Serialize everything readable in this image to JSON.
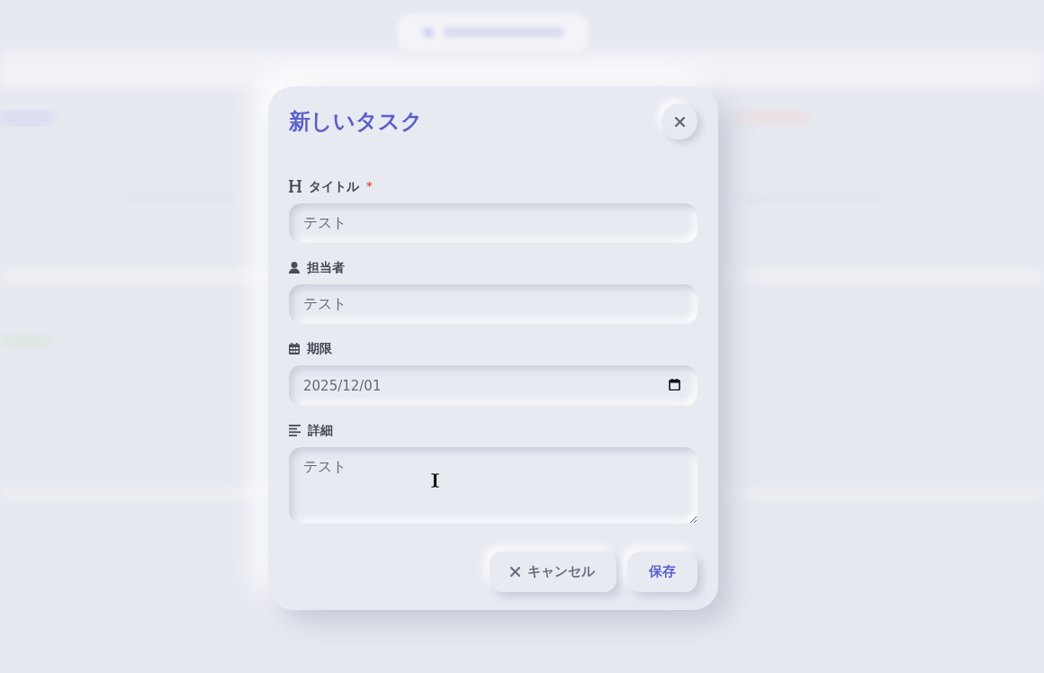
{
  "dialog": {
    "title": "新しいタスク",
    "fields": [
      {
        "kind": "text",
        "label": "タイトル",
        "required_mark": "*",
        "value": "テスト"
      },
      {
        "kind": "text",
        "label": "担当者",
        "value": "テスト"
      },
      {
        "kind": "date",
        "label": "期限",
        "value": "2025/12/01"
      },
      {
        "kind": "textarea",
        "label": "詳細",
        "value": "テスト"
      }
    ],
    "buttons": [
      {
        "kind": "cancel",
        "label": "キャンセル"
      },
      {
        "kind": "save",
        "label": "保存"
      }
    ]
  }
}
